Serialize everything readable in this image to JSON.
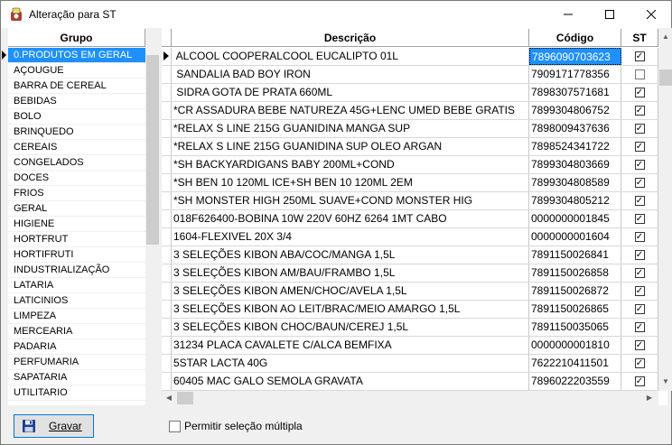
{
  "window": {
    "title": "Alteração para ST"
  },
  "grupo": {
    "header": "Grupo",
    "items": [
      "0.PRODUTOS EM GERAL",
      "AÇOUGUE",
      "BARRA DE CEREAL",
      "BEBIDAS",
      "BOLO",
      "BRINQUEDO",
      "CEREAIS",
      "CONGELADOS",
      "DOCES",
      "FRIOS",
      "GERAL",
      "HIGIENE",
      "HORTFRUT",
      "HORTIFRUTI",
      "INDUSTRIALIZAÇÃO",
      "LATARIA",
      "LATICINIOS",
      "LIMPEZA",
      "MERCEARIA",
      "PADARIA",
      "PERFUMARIA",
      "SAPATARIA",
      "UTILITARIO"
    ],
    "selected_index": 0
  },
  "grid": {
    "headers": {
      "descricao": "Descrição",
      "codigo": "Código",
      "st": "ST"
    },
    "rows": [
      {
        "descricao": " ALCOOL COOPERALCOOL EUCALIPTO 01L",
        "codigo": "7896090703623",
        "st": true
      },
      {
        "descricao": " SANDALIA BAD BOY IRON",
        "codigo": "7909171778356",
        "st": false
      },
      {
        "descricao": " SIDRA GOTA DE PRATA 660ML",
        "codigo": "7898307571681",
        "st": true
      },
      {
        "descricao": "*CR ASSADURA BEBE NATUREZA 45G+LENC UMED BEBE GRATIS",
        "codigo": "7899304806752",
        "st": true
      },
      {
        "descricao": "*RELAX S LINE 215G GUANIDINA MANGA SUP",
        "codigo": "7898009437636",
        "st": true
      },
      {
        "descricao": "*RELAX S LINE 215G GUANIDINA SUP OLEO ARGAN",
        "codigo": "7898524341722",
        "st": true
      },
      {
        "descricao": "*SH BACKYARDIGANS BABY 200ML+COND",
        "codigo": "7899304803669",
        "st": true
      },
      {
        "descricao": "*SH BEN 10 120ML ICE+SH BEN 10 120ML 2EM",
        "codigo": "7899304808589",
        "st": true
      },
      {
        "descricao": "*SH MONSTER HIGH 250ML SUAVE+COND MONSTER HIG",
        "codigo": "7899304805212",
        "st": true
      },
      {
        "descricao": "018F626400-BOBINA 10W 220V 60HZ 6264 1MT CABO",
        "codigo": "0000000001845",
        "st": true
      },
      {
        "descricao": "1604-FLEXIVEL 20X 3/4",
        "codigo": "0000000001604",
        "st": true
      },
      {
        "descricao": "3 SELEÇÕES KIBON ABA/COC/MANGA 1,5L",
        "codigo": "7891150026841",
        "st": true
      },
      {
        "descricao": "3 SELEÇÕES KIBON AM/BAU/FRAMBO 1,5L",
        "codigo": "7891150026858",
        "st": true
      },
      {
        "descricao": "3 SELEÇÕES KIBON AMEN/CHOC/AVELA 1,5L",
        "codigo": "7891150026872",
        "st": true
      },
      {
        "descricao": "3 SELEÇÕES KIBON AO LEIT/BRAC/MEIO AMARGO 1,5L",
        "codigo": "7891150026865",
        "st": true
      },
      {
        "descricao": "3 SELEÇÕES KIBON CHOC/BAUN/CEREJ 1,5L",
        "codigo": "7891150035065",
        "st": true
      },
      {
        "descricao": "31234 PLACA CAVALETE C/ALCA BEMFIXA",
        "codigo": "0000000001810",
        "st": true
      },
      {
        "descricao": "5STAR LACTA 40G",
        "codigo": "7622210411501",
        "st": true
      },
      {
        "descricao": "60405 MAC GALO SEMOLA GRAVATA",
        "codigo": "7896022203559",
        "st": true
      }
    ],
    "selected_row": 0
  },
  "footer": {
    "gravar_label": "Gravar",
    "multi_label": "Permitir seleção múltipla",
    "multi_checked": false
  },
  "colors": {
    "selection": "#1e90ff",
    "button_border": "#0078d7"
  }
}
